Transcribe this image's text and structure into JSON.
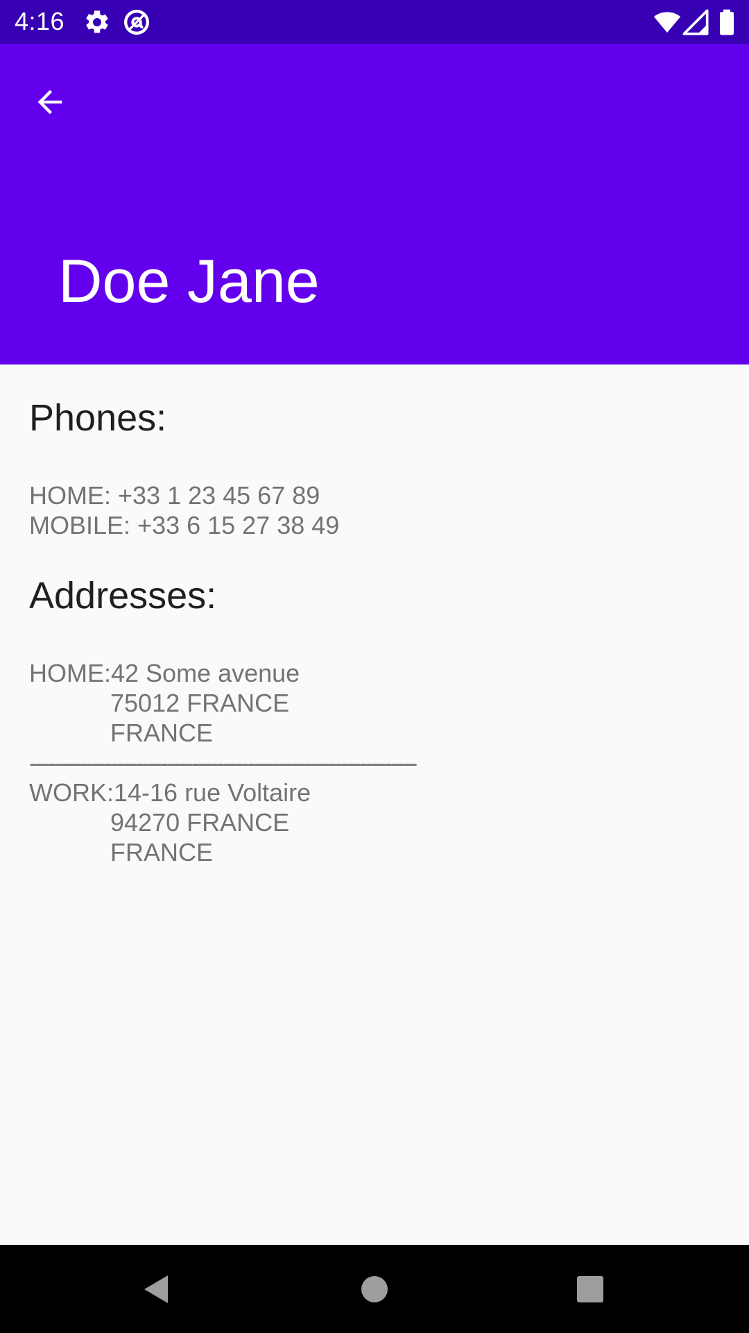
{
  "status_bar": {
    "time": "4:16",
    "icons": [
      "gear-icon",
      "at-sign-icon",
      "wifi-icon",
      "cellular-signal-icon",
      "battery-icon"
    ]
  },
  "app_bar": {
    "back_icon": "arrow-back-icon",
    "title": "Doe Jane",
    "background_color": "#6200ee",
    "status_bar_color": "#3700b3"
  },
  "phones": {
    "heading": "Phones:",
    "entries": [
      "HOME: +33 1 23 45 67 89",
      "MOBILE: +33 6 15 27 38 49"
    ]
  },
  "addresses": {
    "heading": "Addresses:",
    "entries": [
      {
        "first_line": "HOME:42 Some avenue",
        "postal_line": "75012 FRANCE",
        "country_line": "FRANCE"
      },
      {
        "first_line": "WORK:14-16 rue Voltaire",
        "postal_line": "94270 FRANCE",
        "country_line": "FRANCE"
      }
    ],
    "separator": "--------------------------------------------------------------"
  },
  "nav_bar": {
    "icons": [
      "back-triangle-icon",
      "home-circle-icon",
      "recents-square-icon"
    ]
  }
}
